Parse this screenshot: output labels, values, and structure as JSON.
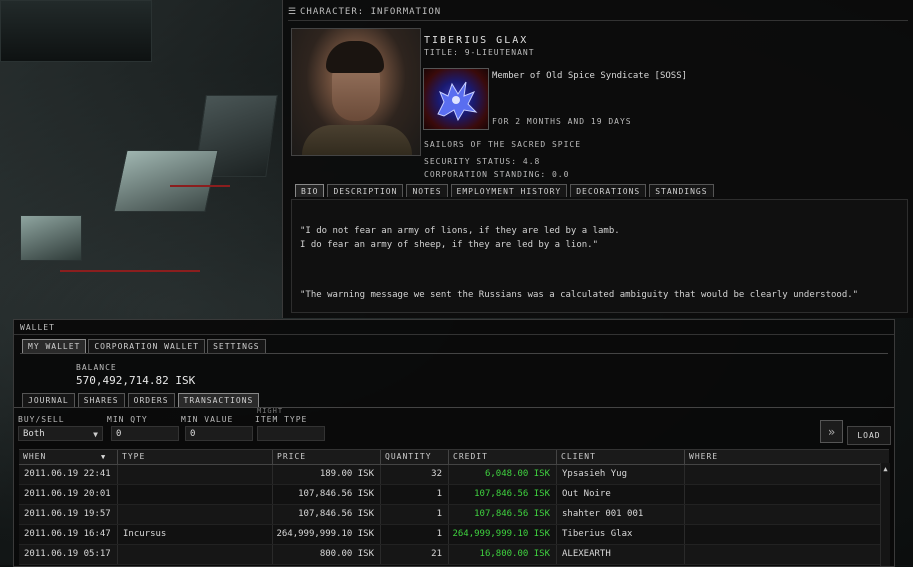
{
  "character": {
    "header": "CHARACTER: INFORMATION",
    "name": "TIBERIUS GLAX",
    "title": "TITLE: 9-LIEUTENANT",
    "corp_membership": "Member of Old Spice Syndicate [SOSS]",
    "corp_duration": "FOR 2 MONTHS AND 19 DAYS",
    "alliance": "SAILORS OF THE SACRED SPICE",
    "security_status": "SECURITY STATUS: 4.8",
    "corp_standing": "CORPORATION STANDING: 0.0",
    "tabs": [
      {
        "label": "BIO",
        "active": true
      },
      {
        "label": "DESCRIPTION",
        "active": false
      },
      {
        "label": "NOTES",
        "active": false
      },
      {
        "label": "EMPLOYMENT HISTORY",
        "active": false
      },
      {
        "label": "DECORATIONS",
        "active": false
      },
      {
        "label": "STANDINGS",
        "active": false
      }
    ],
    "bio": {
      "line1": "\"I do not fear an army of lions, if they are led by a lamb.",
      "line2": "I do fear an army of sheep, if they are led by a lion.\"",
      "line3": "\"The warning message we sent the Russians was a calculated ambiguity that would be clearly understood.\""
    }
  },
  "wallet": {
    "header": "WALLET",
    "tabs": {
      "my_wallet": "MY WALLET",
      "corp_wallet": "CORPORATION WALLET",
      "settings": "SETTINGS"
    },
    "balance_label": "BALANCE",
    "balance_value": "570,492,714.82 ISK",
    "subtabs": {
      "journal": "JOURNAL",
      "shares": "SHARES",
      "orders": "ORDERS",
      "transactions": "TRANSACTIONS"
    },
    "filters": {
      "buysell_label": "BUY/SELL",
      "buysell_value": "Both",
      "minqty_label": "MIN QTY",
      "minqty_value": "0",
      "minvalue_label": "MIN VALUE",
      "minvalue_value": "0",
      "itemtype_label": "ITEM TYPE",
      "itemtype_value": "",
      "might_label": "MIGHT"
    },
    "load_label": "LOAD",
    "columns": {
      "when": "WHEN",
      "type": "TYPE",
      "price": "PRICE",
      "quantity": "QUANTITY",
      "credit": "CREDIT",
      "client": "CLIENT",
      "where": "WHERE"
    },
    "rows": [
      {
        "when": "2011.06.19 22:41",
        "type": "",
        "price": "189.00 ISK",
        "quantity": "32",
        "credit": "6,048.00 ISK",
        "client": "Ypsasieh Yug",
        "where": ""
      },
      {
        "when": "2011.06.19 20:01",
        "type": "",
        "price": "107,846.56 ISK",
        "quantity": "1",
        "credit": "107,846.56 ISK",
        "client": "Out Noire",
        "where": ""
      },
      {
        "when": "2011.06.19 19:57",
        "type": "",
        "price": "107,846.56 ISK",
        "quantity": "1",
        "credit": "107,846.56 ISK",
        "client": "shahter 001 001",
        "where": ""
      },
      {
        "when": "2011.06.19 16:47",
        "type": "Incursus",
        "price": "264,999,999.10 ISK",
        "quantity": "1",
        "credit": "264,999,999.10 ISK",
        "client": "Tiberius Glax",
        "where": ""
      },
      {
        "when": "2011.06.19 05:17",
        "type": "",
        "price": "800.00 ISK",
        "quantity": "21",
        "credit": "16,800.00 ISK",
        "client": "ALEXEARTH",
        "where": ""
      }
    ]
  },
  "colors": {
    "credit_positive": "#3fd23f",
    "panel_bg": "#0c0c0c"
  },
  "icons": [
    "menu-icon",
    "character-portrait",
    "corp-logo-griffin",
    "load-arrows-icon",
    "sort-down-icon",
    "scroll-up-icon"
  ]
}
